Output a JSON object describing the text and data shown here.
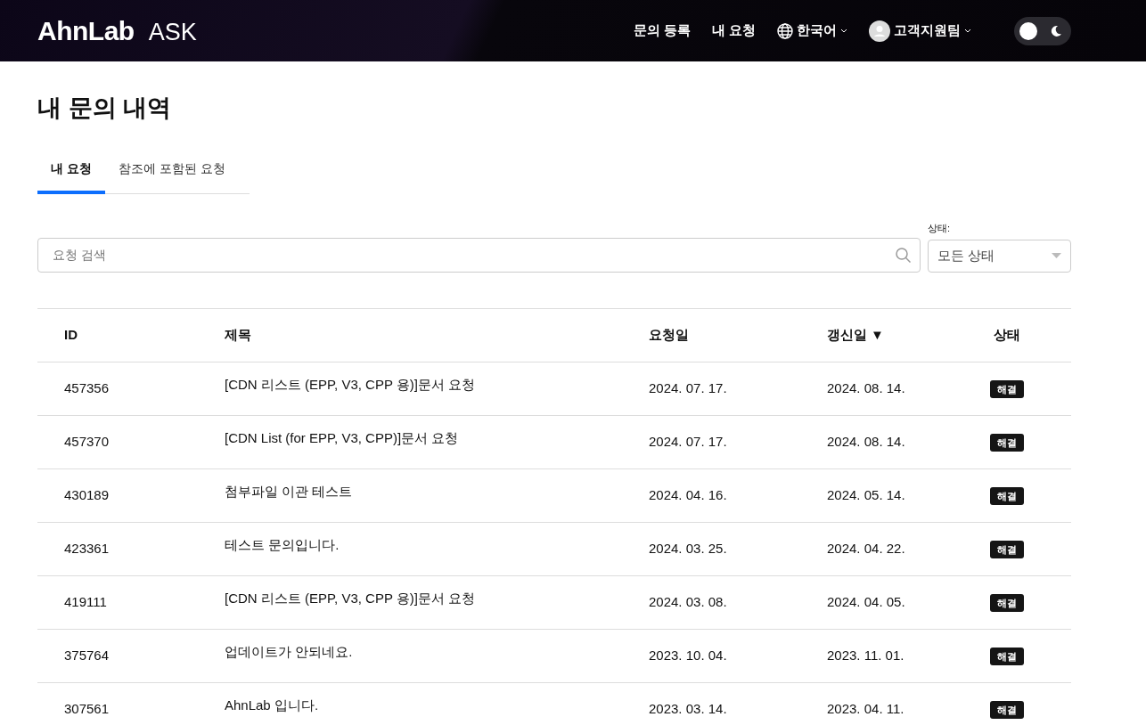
{
  "header": {
    "logo": "AhnLab",
    "product": "ASK",
    "nav": [
      "문의 등록",
      "내 요청"
    ],
    "language": "한국어",
    "user": "고객지원팀",
    "dark_mode": false
  },
  "page_title": "내 문의 내역",
  "tabs": [
    {
      "label": "내 요청",
      "selected": true
    },
    {
      "label": "참조에 포함된 요청",
      "selected": false
    }
  ],
  "search": {
    "placeholder": "요청 검색"
  },
  "status_filter": {
    "label": "상태:",
    "value": "모든 상태"
  },
  "table": {
    "columns": [
      {
        "label": "ID",
        "sorted": false
      },
      {
        "label": "제목",
        "sorted": false
      },
      {
        "label": "요청일",
        "sorted": false
      },
      {
        "label": "갱신일",
        "sorted": true
      },
      {
        "label": "상태",
        "sorted": false
      }
    ],
    "sort_indicator": "▼",
    "rows": [
      {
        "id": "457356",
        "title": "[CDN 리스트 (EPP, V3, CPP 용)]문서 요청",
        "requested": "2024. 07. 17.",
        "updated": "2024. 08. 14.",
        "status": "해결"
      },
      {
        "id": "457370",
        "title": "[CDN List (for EPP, V3, CPP)]문서 요청",
        "requested": "2024. 07. 17.",
        "updated": "2024. 08. 14.",
        "status": "해결"
      },
      {
        "id": "430189",
        "title": "첨부파일 이관 테스트",
        "requested": "2024. 04. 16.",
        "updated": "2024. 05. 14.",
        "status": "해결"
      },
      {
        "id": "423361",
        "title": "테스트 문의입니다.",
        "requested": "2024. 03. 25.",
        "updated": "2024. 04. 22.",
        "status": "해결"
      },
      {
        "id": "419111",
        "title": "[CDN 리스트 (EPP, V3, CPP 용)]문서 요청",
        "requested": "2024. 03. 08.",
        "updated": "2024. 04. 05.",
        "status": "해결"
      },
      {
        "id": "375764",
        "title": "업데이트가 안되네요.",
        "requested": "2023. 10. 04.",
        "updated": "2023. 11. 01.",
        "status": "해결"
      },
      {
        "id": "307561",
        "title": "AhnLab 입니다.",
        "requested": "2023. 03. 14.",
        "updated": "2023. 04. 11.",
        "status": "해결"
      }
    ]
  }
}
